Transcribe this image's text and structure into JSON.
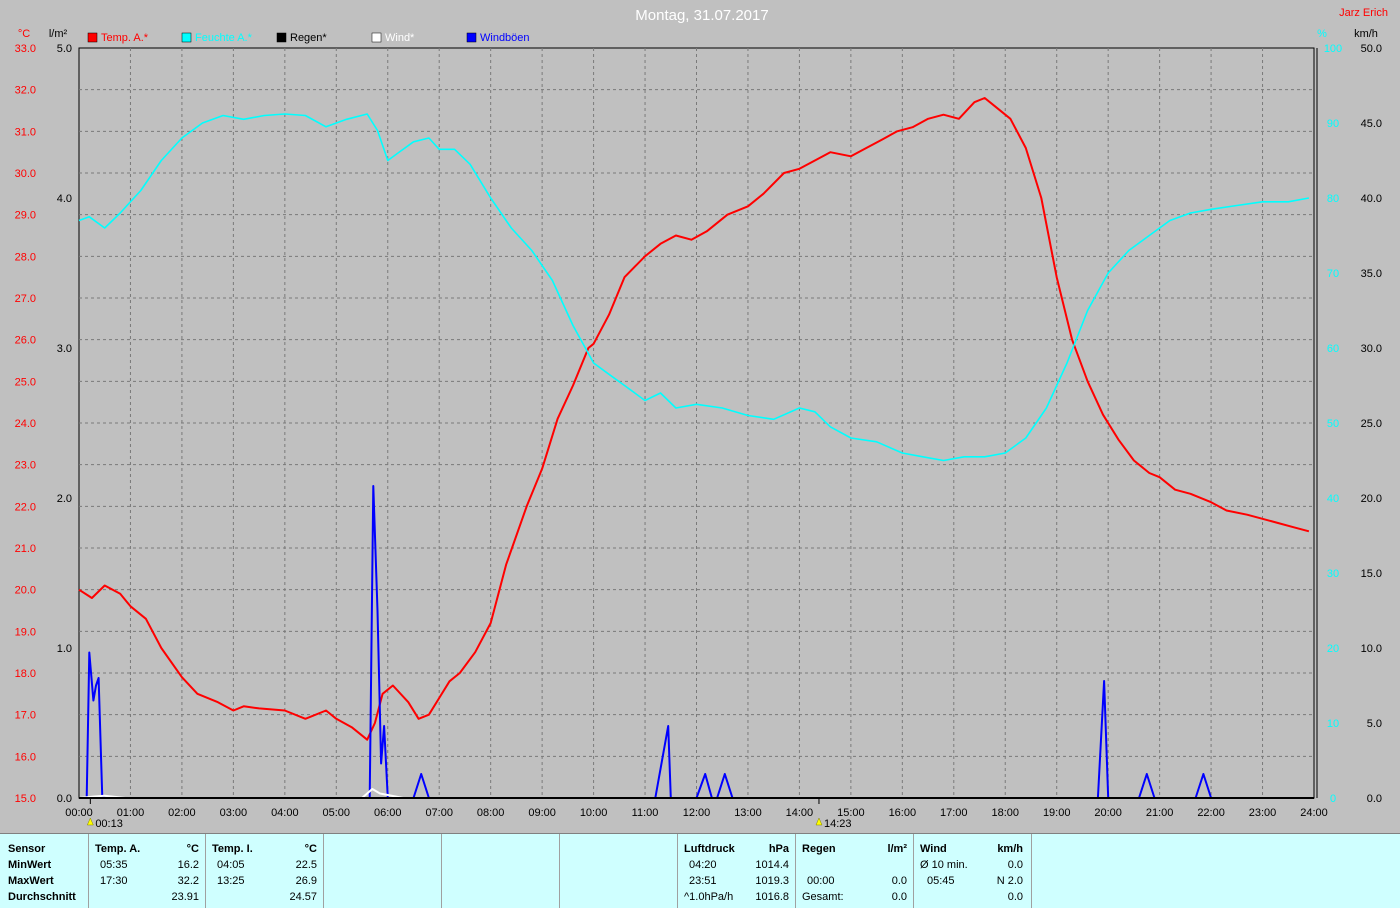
{
  "header": {
    "title": "Montag, 31.07.2017",
    "author": "Jarz Erich"
  },
  "units": {
    "temp": "°C",
    "rain": "l/m²",
    "humidity": "%",
    "wind": "km/h"
  },
  "legend": [
    {
      "label": "Temp. A.*",
      "color": "#ff0000"
    },
    {
      "label": "Feuchte A.*",
      "color": "#00ffff"
    },
    {
      "label": "Regen*",
      "color": "#000000"
    },
    {
      "label": "Wind*",
      "color": "#ffffff"
    },
    {
      "label": "Windböen",
      "color": "#0000ff"
    }
  ],
  "markers": [
    {
      "time": "00:13",
      "hour": 0.22
    },
    {
      "time": "14:23",
      "hour": 14.38
    }
  ],
  "chart_data": {
    "type": "line",
    "x_label_hours": [
      "00:00",
      "01:00",
      "02:00",
      "03:00",
      "04:00",
      "05:00",
      "06:00",
      "07:00",
      "08:00",
      "09:00",
      "10:00",
      "11:00",
      "12:00",
      "13:00",
      "14:00",
      "15:00",
      "16:00",
      "17:00",
      "18:00",
      "19:00",
      "20:00",
      "21:00",
      "22:00",
      "23:00",
      "24:00"
    ],
    "xlim": [
      0,
      24
    ],
    "axes": {
      "temp": {
        "min": 15.0,
        "max": 33.0,
        "ticks": [
          "15.0",
          "16.0",
          "17.0",
          "18.0",
          "19.0",
          "20.0",
          "21.0",
          "22.0",
          "23.0",
          "24.0",
          "25.0",
          "26.0",
          "27.0",
          "28.0",
          "29.0",
          "30.0",
          "31.0",
          "32.0",
          "33.0"
        ]
      },
      "rain": {
        "min": 0,
        "max": 5,
        "ticks": [
          "0.0",
          "1.0",
          "2.0",
          "3.0",
          "4.0",
          "5.0"
        ]
      },
      "humidity": {
        "min": 0,
        "max": 100,
        "ticks": [
          "0",
          "10",
          "20",
          "30",
          "40",
          "50",
          "60",
          "70",
          "80",
          "90",
          "100"
        ]
      },
      "wind": {
        "min": 0,
        "max": 50,
        "ticks": [
          "0.0",
          "5.0",
          "10.0",
          "15.0",
          "20.0",
          "25.0",
          "30.0",
          "35.0",
          "40.0",
          "45.0",
          "50.0"
        ]
      }
    },
    "grid": true,
    "series": [
      {
        "name": "Temp. A.*",
        "axis": "temp",
        "color": "#ff0000",
        "x": [
          0,
          0.25,
          0.5,
          0.8,
          1,
          1.3,
          1.6,
          2,
          2.3,
          2.7,
          3,
          3.2,
          3.5,
          4,
          4.4,
          4.8,
          5,
          5.3,
          5.6,
          5.75,
          5.9,
          6.1,
          6.4,
          6.6,
          6.8,
          7,
          7.2,
          7.4,
          7.7,
          8,
          8.3,
          8.7,
          9,
          9.3,
          9.6,
          9.9,
          10,
          10.3,
          10.6,
          11,
          11.3,
          11.6,
          11.9,
          12.2,
          12.6,
          13,
          13.3,
          13.7,
          14,
          14.3,
          14.6,
          15,
          15.3,
          15.6,
          15.9,
          16.2,
          16.5,
          16.8,
          17.1,
          17.4,
          17.6,
          17.8,
          18.1,
          18.4,
          18.7,
          19,
          19.3,
          19.6,
          19.9,
          20.2,
          20.5,
          20.8,
          21,
          21.3,
          21.6,
          22,
          22.3,
          22.7,
          23,
          23.3,
          23.6,
          23.9
        ],
        "y": [
          20.0,
          19.8,
          20.1,
          19.9,
          19.6,
          19.3,
          18.6,
          17.9,
          17.5,
          17.3,
          17.1,
          17.2,
          17.15,
          17.1,
          16.9,
          17.1,
          16.9,
          16.7,
          16.4,
          16.8,
          17.5,
          17.7,
          17.3,
          16.9,
          17.0,
          17.4,
          17.8,
          18.0,
          18.5,
          19.2,
          20.6,
          22.0,
          22.9,
          24.1,
          24.9,
          25.8,
          25.9,
          26.6,
          27.5,
          28.0,
          28.3,
          28.5,
          28.4,
          28.6,
          29.0,
          29.2,
          29.5,
          30.0,
          30.1,
          30.3,
          30.5,
          30.4,
          30.6,
          30.8,
          31.0,
          31.1,
          31.3,
          31.4,
          31.3,
          31.7,
          31.8,
          31.6,
          31.3,
          30.6,
          29.4,
          27.5,
          26.0,
          25.0,
          24.2,
          23.6,
          23.1,
          22.8,
          22.7,
          22.4,
          22.3,
          22.1,
          21.9,
          21.8,
          21.7,
          21.6,
          21.5,
          21.4
        ]
      },
      {
        "name": "Feuchte A.*",
        "axis": "humidity",
        "color": "#00ffff",
        "x": [
          0,
          0.2,
          0.5,
          0.8,
          1.2,
          1.6,
          2,
          2.4,
          2.8,
          3.2,
          3.6,
          4,
          4.4,
          4.8,
          5.2,
          5.6,
          5.8,
          6,
          6.2,
          6.5,
          6.8,
          7,
          7.3,
          7.6,
          8,
          8.4,
          8.8,
          9.2,
          9.6,
          10,
          10.3,
          10.6,
          11,
          11.3,
          11.6,
          12,
          12.5,
          13,
          13.5,
          14,
          14.3,
          14.6,
          15,
          15.5,
          16,
          16.4,
          16.8,
          17.2,
          17.6,
          18,
          18.4,
          18.8,
          19.2,
          19.6,
          20,
          20.4,
          20.8,
          21.2,
          21.6,
          22,
          22.5,
          23,
          23.5,
          23.9
        ],
        "y": [
          77,
          77.5,
          76,
          78,
          81,
          85,
          88,
          90,
          91,
          90.5,
          91,
          91.2,
          91,
          89.5,
          90.5,
          91.2,
          89,
          85,
          86,
          87.5,
          88,
          86.5,
          86.5,
          84.5,
          80,
          76,
          73,
          69,
          63,
          58,
          56.5,
          55,
          53,
          54,
          52,
          52.5,
          52,
          51,
          50.5,
          52,
          51.5,
          49.5,
          48,
          47.5,
          46,
          45.5,
          45,
          45.5,
          45.5,
          46,
          48,
          52,
          58,
          65,
          70,
          73,
          75,
          77,
          78,
          78.5,
          79,
          79.5,
          79.5,
          80
        ]
      },
      {
        "name": "Windböen",
        "axis": "wind",
        "color": "#0000ff",
        "x": [
          0,
          0.15,
          0.2,
          0.28,
          0.33,
          0.38,
          0.45,
          0.5,
          5.6,
          5.65,
          5.72,
          5.8,
          5.87,
          5.93,
          6.0,
          6.05,
          6.1,
          6.5,
          6.65,
          6.8,
          11.2,
          11.45,
          11.5,
          11.7,
          12.0,
          12.17,
          12.3,
          12.4,
          12.55,
          12.7,
          12.8,
          19.8,
          19.92,
          20.0,
          20.6,
          20.75,
          20.9,
          21.7,
          21.85,
          22.0
        ],
        "y": [
          0,
          0,
          9.7,
          6.5,
          7.5,
          8.0,
          0.2,
          0,
          0,
          0,
          20.8,
          12.5,
          2.3,
          4.8,
          0,
          0,
          0,
          0,
          1.6,
          0,
          0,
          4.8,
          0,
          0,
          0,
          1.6,
          0,
          0,
          1.6,
          0,
          0,
          0,
          7.8,
          0,
          0,
          1.6,
          0,
          0,
          1.6,
          0
        ]
      },
      {
        "name": "Wind*",
        "axis": "wind",
        "color": "#ffffff",
        "x": [
          0,
          0.3,
          0.5,
          0.9,
          5.5,
          5.7,
          5.85,
          6.0,
          6.3,
          24
        ],
        "y": [
          0,
          0.1,
          0.15,
          0,
          0,
          0.6,
          0.3,
          0.2,
          0,
          0
        ]
      },
      {
        "name": "Regen*",
        "axis": "rain",
        "color": "#000000",
        "x": [
          0,
          24
        ],
        "y": [
          0,
          0
        ]
      }
    ]
  },
  "stats": {
    "col1": {
      "header": "Sensor",
      "rows": [
        "MinWert",
        "MaxWert",
        "Durchschnitt"
      ]
    },
    "tempA": {
      "header": "Temp. A.",
      "unit": "°C",
      "min_time": "05:35",
      "min": "16.2",
      "max_time": "17:30",
      "max": "32.2",
      "avg": "23.91"
    },
    "tempI": {
      "header": "Temp. I.",
      "unit": "°C",
      "min_time": "04:05",
      "min": "22.5",
      "max_time": "13:25",
      "max": "26.9",
      "avg": "24.57"
    },
    "pressure": {
      "header": "Luftdruck",
      "unit": "hPa",
      "min_time": "04:20",
      "min": "1014.4",
      "max_time": "23:51",
      "max": "1019.3",
      "trend": "^1.0hPa/h",
      "avg": "1016.8"
    },
    "rain": {
      "header": "Regen",
      "unit": "l/m²",
      "row2_time": "00:00",
      "row2": "0.0",
      "row1": "0.0",
      "total_label": "Gesamt:",
      "total": "0.0"
    },
    "wind": {
      "header": "Wind",
      "unit": "km/h",
      "avg_label": "Ø 10 min.",
      "avg": "0.0",
      "max_time": "05:45",
      "max": "N 2.0",
      "row3": "0.0"
    }
  }
}
